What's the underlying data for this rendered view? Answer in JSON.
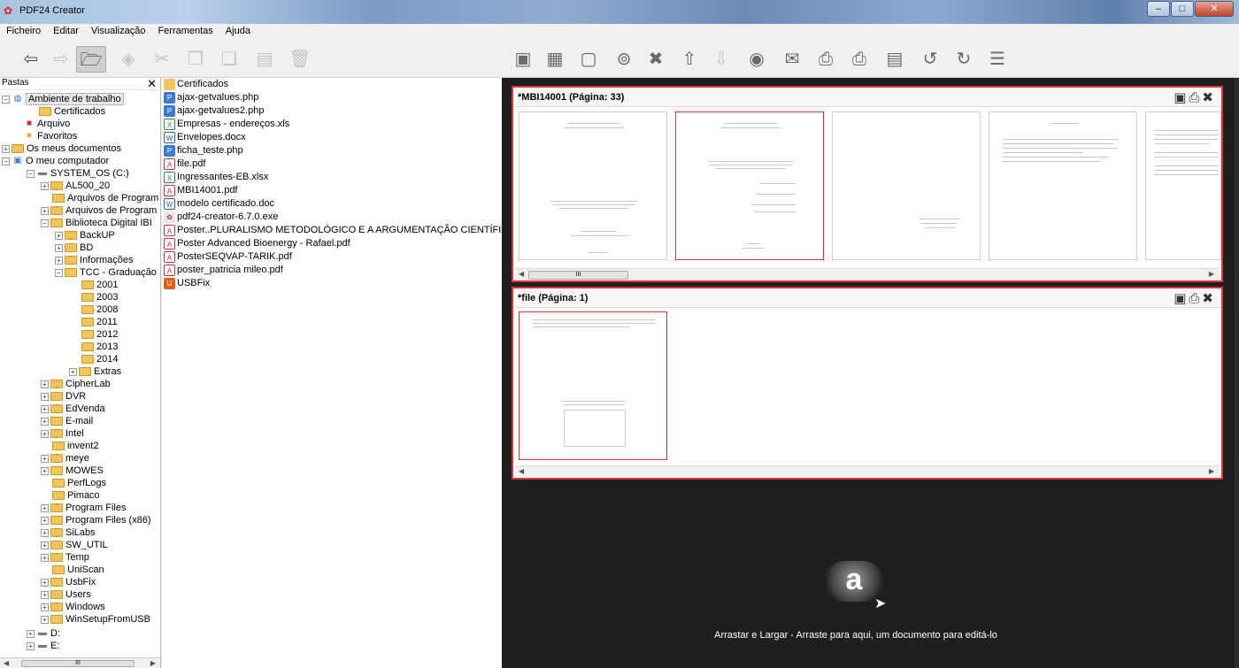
{
  "window": {
    "title": "PDF24 Creator"
  },
  "menu": [
    "Ficheiro",
    "Editar",
    "Visualização",
    "Ferramentas",
    "Ajuda"
  ],
  "left_pane": {
    "header": "Pastas",
    "tree": [
      {
        "label": "Ambiente de trabalho",
        "selected": true
      },
      {
        "label": "Certificados"
      },
      {
        "label": "Arquivo"
      },
      {
        "label": "Favoritos"
      },
      {
        "label": "Os meus documentos"
      },
      {
        "label": "O meu computador"
      },
      {
        "label": "SYSTEM_OS (C:)"
      },
      {
        "label": "AL500_20"
      },
      {
        "label": "Arquivos de Program"
      },
      {
        "label": "Arquivos de Program"
      },
      {
        "label": "Biblioteca Digital IBI"
      },
      {
        "label": "BackUP"
      },
      {
        "label": "BD"
      },
      {
        "label": "Informações"
      },
      {
        "label": "TCC - Graduação"
      },
      {
        "label": "2001"
      },
      {
        "label": "2003"
      },
      {
        "label": "2008"
      },
      {
        "label": "2011"
      },
      {
        "label": "2012"
      },
      {
        "label": "2013"
      },
      {
        "label": "2014"
      },
      {
        "label": "Extras"
      },
      {
        "label": "CipherLab"
      },
      {
        "label": "DVR"
      },
      {
        "label": "EdVenda"
      },
      {
        "label": "E-mail"
      },
      {
        "label": "Intel"
      },
      {
        "label": "invent2"
      },
      {
        "label": "meye"
      },
      {
        "label": "MOWES"
      },
      {
        "label": "PerfLogs"
      },
      {
        "label": "Pimaco"
      },
      {
        "label": "Program Files"
      },
      {
        "label": "Program Files (x86)"
      },
      {
        "label": "SiLabs"
      },
      {
        "label": "SW_UTIL"
      },
      {
        "label": "Temp"
      },
      {
        "label": "UniScan"
      },
      {
        "label": "UsbFix"
      },
      {
        "label": "Users"
      },
      {
        "label": "Windows"
      },
      {
        "label": "WinSetupFromUSB"
      },
      {
        "label": "D:"
      },
      {
        "label": "E:"
      }
    ]
  },
  "files": [
    {
      "name": "Certificados",
      "type": "folder"
    },
    {
      "name": "ajax-getvalues.php",
      "type": "php"
    },
    {
      "name": "ajax-getvalues2.php",
      "type": "php"
    },
    {
      "name": "Empresas - endereços.xls",
      "type": "xls"
    },
    {
      "name": "Envelopes.docx",
      "type": "doc"
    },
    {
      "name": "ficha_teste.php",
      "type": "php"
    },
    {
      "name": "file.pdf",
      "type": "pdf"
    },
    {
      "name": "Ingressantes-EB.xlsx",
      "type": "xls"
    },
    {
      "name": "MBI14001.pdf",
      "type": "pdf"
    },
    {
      "name": "modelo certificado.doc",
      "type": "doc"
    },
    {
      "name": "pdf24-creator-6.7.0.exe",
      "type": "exe"
    },
    {
      "name": "Poster..PLURALISMO METODOLÓGICO E A ARGUMENTAÇÃO CIENTÍFICA",
      "type": "pdf"
    },
    {
      "name": "Poster Advanced Bioenergy - Rafael.pdf",
      "type": "pdf"
    },
    {
      "name": "PosterSEQVAP-TARIK.pdf",
      "type": "pdf"
    },
    {
      "name": "poster_patricia mileo.pdf",
      "type": "pdf"
    },
    {
      "name": "USBFix",
      "type": "usb"
    }
  ],
  "documents": [
    {
      "title": "*MBI14001 (Página: 33)"
    },
    {
      "title": "*file (Página: 1)"
    }
  ],
  "dropzone": {
    "text": "Arrastar e Largar - Arraste para aqui, um documento para editá-lo",
    "logo": "a"
  },
  "scroll_thumb": "III",
  "colors": {
    "accent_border": "#dd3333",
    "workspace_bg": "#1f1f1f",
    "folder": "#f2c55c"
  }
}
